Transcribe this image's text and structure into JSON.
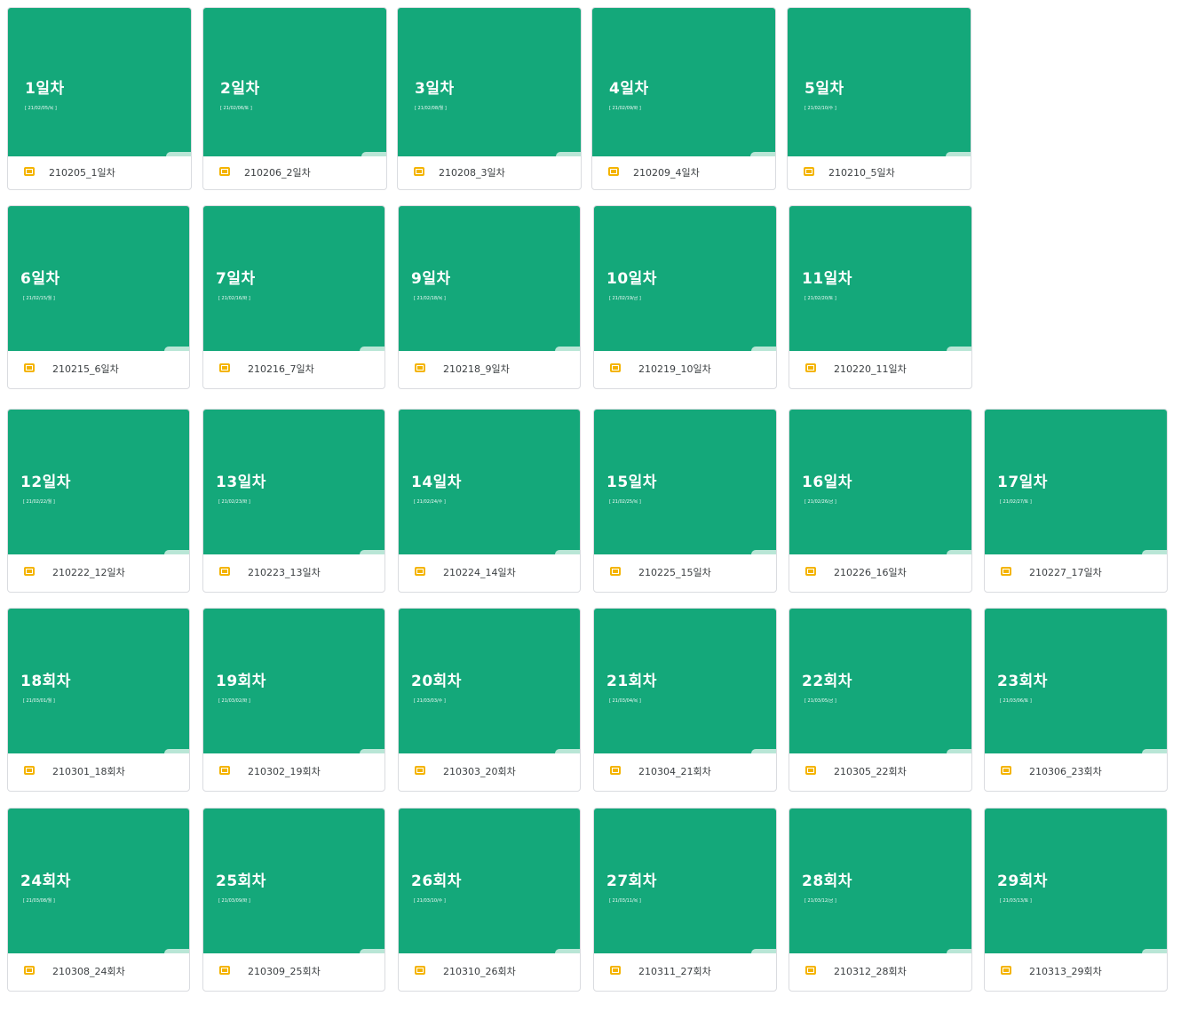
{
  "colors": {
    "slide_bg": "#14a87a",
    "icon": "#f4b400"
  },
  "icon_name": "google-slides-icon",
  "files": [
    {
      "title": "1일차",
      "date": "[ 21/02/05/목 ]",
      "name": "210205_1일차"
    },
    {
      "title": "2일차",
      "date": "[ 21/02/06/토 ]",
      "name": "210206_2일차"
    },
    {
      "title": "3일차",
      "date": "[ 21/02/08/월 ]",
      "name": "210208_3일차"
    },
    {
      "title": "4일차",
      "date": "[ 21/02/09/화 ]",
      "name": "210209_4일차"
    },
    {
      "title": "5일차",
      "date": "[ 21/02/10/수 ]",
      "name": "210210_5일차"
    },
    {
      "title": "6일차",
      "date": "[ 21/02/15/월 ]",
      "name": "210215_6일차"
    },
    {
      "title": "7일차",
      "date": "[ 21/02/16/화 ]",
      "name": "210216_7일차"
    },
    {
      "title": "9일차",
      "date": "[ 21/02/18/목 ]",
      "name": "210218_9일차"
    },
    {
      "title": "10일차",
      "date": "[ 21/02/19/금 ]",
      "name": "210219_10일차"
    },
    {
      "title": "11일차",
      "date": "[ 21/02/20/토 ]",
      "name": "210220_11일차"
    },
    {
      "title": "12일차",
      "date": "[ 21/02/22/월 ]",
      "name": "210222_12일차"
    },
    {
      "title": "13일차",
      "date": "[ 21/02/23/화 ]",
      "name": "210223_13일차"
    },
    {
      "title": "14일차",
      "date": "[ 21/02/24/수 ]",
      "name": "210224_14일차"
    },
    {
      "title": "15일차",
      "date": "[ 21/02/25/목 ]",
      "name": "210225_15일차"
    },
    {
      "title": "16일차",
      "date": "[ 21/02/26/금 ]",
      "name": "210226_16일차"
    },
    {
      "title": "17일차",
      "date": "[ 21/02/27/토 ]",
      "name": "210227_17일차"
    },
    {
      "title": "18회차",
      "date": "[ 21/03/01/월 ]",
      "name": "210301_18회차"
    },
    {
      "title": "19회차",
      "date": "[ 21/03/02/화 ]",
      "name": "210302_19회차"
    },
    {
      "title": "20회차",
      "date": "[ 21/03/03/수 ]",
      "name": "210303_20회차"
    },
    {
      "title": "21회차",
      "date": "[ 21/03/04/목 ]",
      "name": "210304_21회차"
    },
    {
      "title": "22회차",
      "date": "[ 21/03/05/금 ]",
      "name": "210305_22회차"
    },
    {
      "title": "23회차",
      "date": "[ 21/03/06/토 ]",
      "name": "210306_23회차"
    },
    {
      "title": "24회차",
      "date": "[ 21/03/08/월 ]",
      "name": "210308_24회차"
    },
    {
      "title": "25회차",
      "date": "[ 21/03/09/화 ]",
      "name": "210309_25회차"
    },
    {
      "title": "26회차",
      "date": "[ 21/03/10/수 ]",
      "name": "210310_26회차"
    },
    {
      "title": "27회차",
      "date": "[ 21/03/11/목 ]",
      "name": "210311_27회차"
    },
    {
      "title": "28회차",
      "date": "[ 21/03/12/금 ]",
      "name": "210312_28회차"
    },
    {
      "title": "29회차",
      "date": "[ 21/03/13/토 ]",
      "name": "210313_29회차"
    }
  ]
}
